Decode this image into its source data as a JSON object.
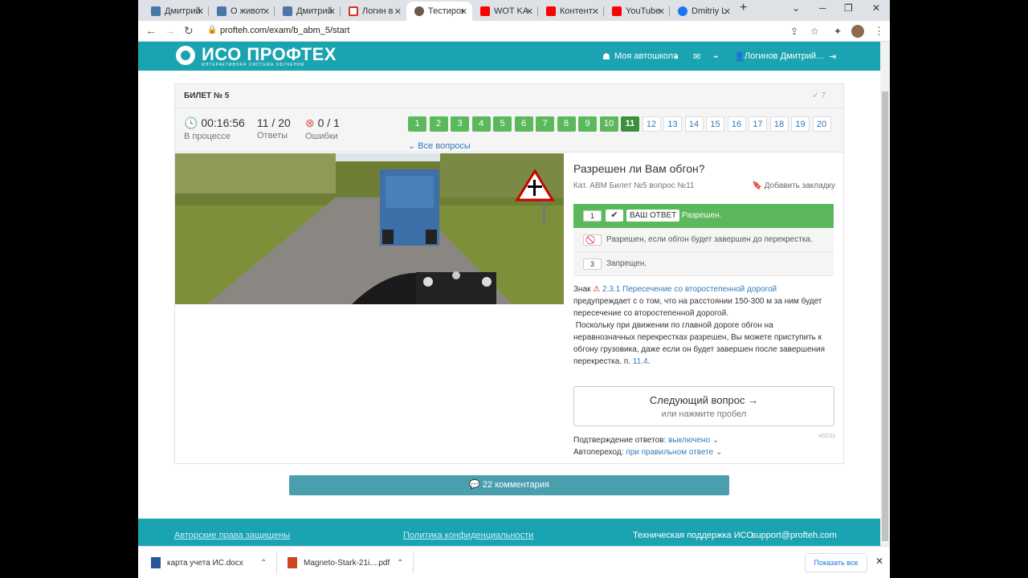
{
  "browser": {
    "tabs": [
      {
        "title": "Дмитрий",
        "icon": "vk-icon",
        "color": "#4a76a8"
      },
      {
        "title": "О живот",
        "icon": "vk-icon",
        "color": "#4a76a8"
      },
      {
        "title": "Дмитрий",
        "icon": "vk-icon",
        "color": "#4a76a8"
      },
      {
        "title": "Логин в",
        "icon": "gmail-icon",
        "color": "#d93025"
      },
      {
        "title": "Тестиров",
        "icon": "profteh-icon",
        "color": "#6b5a4a"
      },
      {
        "title": "WOT KA",
        "icon": "youtube-icon",
        "color": "#ff0000"
      },
      {
        "title": "Контент",
        "icon": "youtube-icon",
        "color": "#ff0000"
      },
      {
        "title": "YouTube",
        "icon": "youtube-icon",
        "color": "#ff0000"
      },
      {
        "title": "Dmitriy L",
        "icon": "facebook-icon",
        "color": "#1877f2"
      }
    ],
    "new_tab": "+",
    "url": "profteh.com/exam/b_abm_5/start"
  },
  "site": {
    "logo": "ИСО ПРОФТЕХ",
    "logo_sub": "ИНТЕРАКТИВНАЯ СИСТЕМА ОБУЧЕНИЯ",
    "nav_school": "Моя автошкола",
    "nav_user": "Логинов Дмитрий..."
  },
  "exam": {
    "ticket_title": "БИЛЕТ № 5",
    "done": "7",
    "timer": "00:16:56",
    "timer_label": "В процессе",
    "answers": "11 / 20",
    "answers_label": "Ответы",
    "errors": "0 / 1",
    "errors_label": "Ошибки",
    "questions": [
      "1",
      "2",
      "3",
      "4",
      "5",
      "6",
      "7",
      "8",
      "9",
      "10",
      "11",
      "12",
      "13",
      "14",
      "15",
      "16",
      "17",
      "18",
      "19",
      "20"
    ],
    "current_question": 11,
    "answered": 10,
    "all_questions": "Все вопросы"
  },
  "question": {
    "title": "Разрешен ли Вам обгон?",
    "meta": "Кат. ABM   Билет №5   вопрос №11",
    "bookmark": "Добавить закладку",
    "answers": [
      {
        "num": "1",
        "badge": "ВАШ ОТВЕТ",
        "text": "Разрешен."
      },
      {
        "num": "",
        "text": "Разрешен, если обгон будет завершен до перекрестка."
      },
      {
        "num": "3",
        "text": "Запрещен."
      }
    ],
    "explain_prefix": "Знак",
    "explain_link": "2.3.1 Пересечение со второстепенной дорогой",
    "explain_body1": "предупреждает с о том, что на расстоянии 150-300 м за ним будет пересечение со второстепенной дорогой.",
    "explain_body2": "Поскольку при движении по главной дороге обгон на неравнозначных перекрестках разрешен, Вы можете приступить к обгону грузовика, даже если он будет завершен после завершения перекрестка. п.",
    "explain_ref": "11.4",
    "explain_end": "."
  },
  "next": {
    "label": "Следующий вопрос →",
    "hint": "или нажмите пробел"
  },
  "options": {
    "confirm_label": "Подтверждение ответов:",
    "confirm_value": "выключено",
    "auto_label": "Автопереход:",
    "auto_value": "при правильном ответе",
    "version": "v01/11"
  },
  "comments": "22 комментария",
  "footer": {
    "copyright": "Авторские права защищены",
    "privacy": "Политика конфиденциальности",
    "support_label": "Техническая поддержка ИСО:",
    "support_email": "support@profteh.com"
  },
  "downloads": {
    "file1": "карта учета ИС.docx",
    "file2": "Magneto-Stark-21i....pdf",
    "show_all": "Показать все"
  },
  "colors": {
    "brand": "#1aa3b0",
    "correct": "#5cb85c",
    "current": "#3c8f3c",
    "link": "#337ab7"
  }
}
